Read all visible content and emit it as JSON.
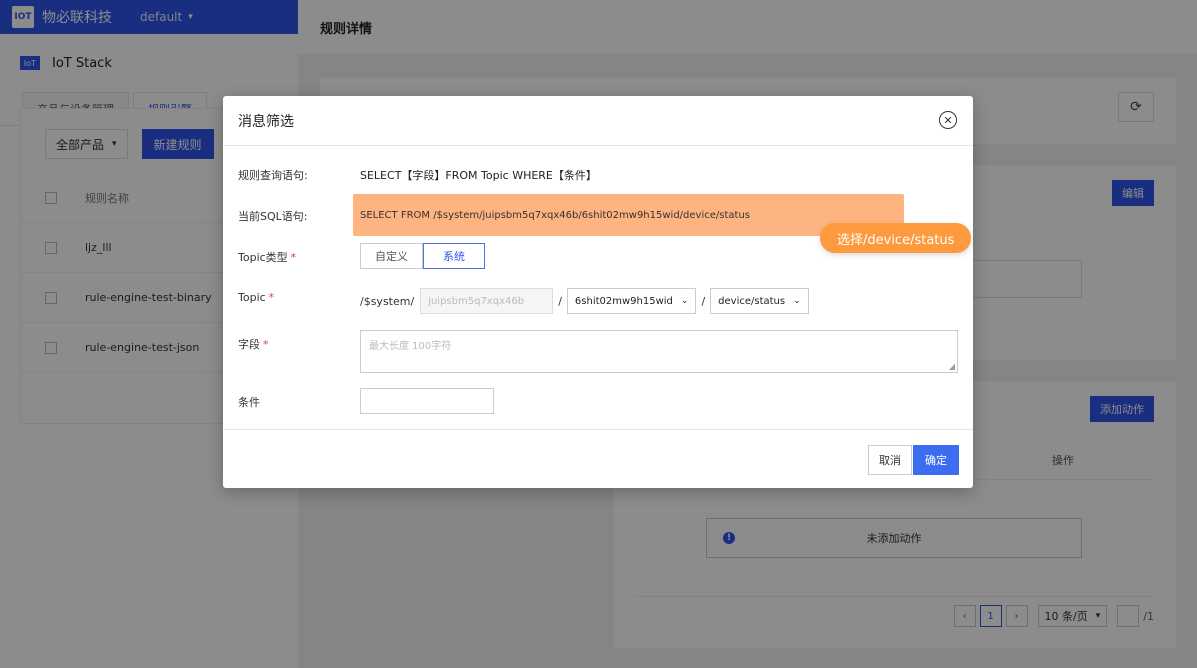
{
  "app": {
    "brand": "物必联科技",
    "workspace": "default",
    "logo_text": "IOT"
  },
  "left": {
    "logo_text": "IoT",
    "title": "IoT Stack",
    "tabs": [
      "产品与设备管理",
      "规则引擎"
    ],
    "product_select": "全部产品",
    "new_rule": "新建规则",
    "col_rule_name": "规则名称",
    "rules": [
      "ljz_lll",
      "rule-engine-test-binary",
      "rule-engine-test-json"
    ]
  },
  "main": {
    "title": "规则详情",
    "edit_label": "编辑",
    "add_action_label": "添加动作",
    "ops_header": "操作",
    "empty_text": "未添加动作",
    "pager": {
      "current": "1",
      "size": "10 条/页",
      "total": "/1"
    }
  },
  "modal": {
    "title": "消息筛选",
    "query_label": "规则查询语句:",
    "query_value": "SELECT【字段】FROM Topic WHERE【条件】",
    "sql_label": "当前SQL语句:",
    "sql_value": "SELECT FROM /$system/juipsbm5q7xqx46b/6shit02mw9h15wid/device/status",
    "tooltip": "选择/device/status",
    "topic_type_label": "Topic类型",
    "topic_type_options": [
      "自定义",
      "系统"
    ],
    "topic_label": "Topic",
    "topic_prefix": "/$system/",
    "topic_product_placeholder": "juipsbm5q7xqx46b",
    "topic_device": "6shit02mw9h15wid",
    "topic_suffix": "device/status",
    "field_label": "字段",
    "field_placeholder": "最大长度 100字符",
    "cond_label": "条件",
    "cancel": "取消",
    "ok": "确定"
  },
  "colors": {
    "primary": "#2f54eb",
    "highlight": "#fdb481",
    "tooltip": "#fd9a3e"
  }
}
